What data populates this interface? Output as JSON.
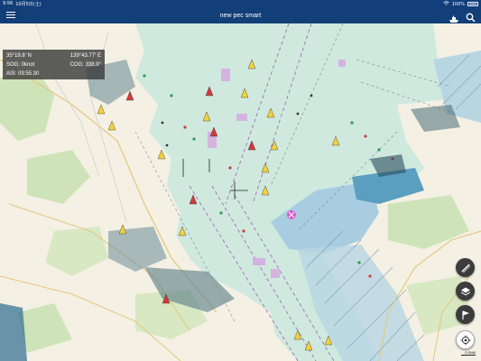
{
  "status_bar": {
    "time": "9:56",
    "date": "10月5日(土)",
    "battery": "100%"
  },
  "app": {
    "title": "new pec smart"
  },
  "info_panel": {
    "latitude": "35°19.8′ N",
    "longitude": "139°43.77′ E",
    "sog": "SOG: 0knot",
    "cog": "COG: 338.9°",
    "ais": "AIS: 09:55:30"
  },
  "map_controls": {
    "scale_label": "0.5NM"
  },
  "colors": {
    "appbar": "#133f78",
    "sea": "#cfe9df",
    "land": "#f4f0e4",
    "fab": "#3c3c3c"
  }
}
